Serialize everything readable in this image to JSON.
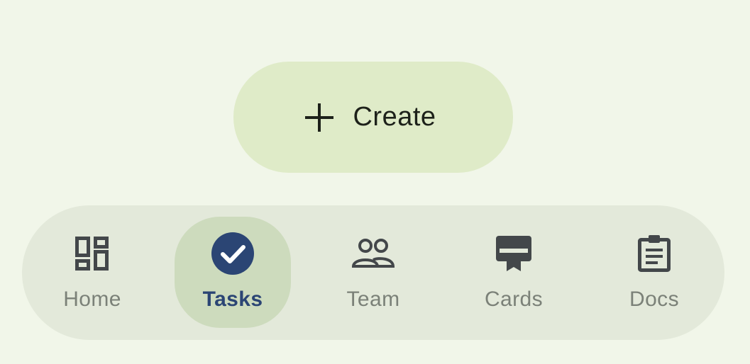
{
  "fab": {
    "label": "Create",
    "icon": "plus-icon"
  },
  "nav": {
    "items": [
      {
        "label": "Home",
        "icon": "dashboard-icon",
        "active": false
      },
      {
        "label": "Tasks",
        "icon": "check-circle-icon",
        "active": true
      },
      {
        "label": "Team",
        "icon": "people-icon",
        "active": false
      },
      {
        "label": "Cards",
        "icon": "card-membership-icon",
        "active": false
      },
      {
        "label": "Docs",
        "icon": "clipboard-icon",
        "active": false
      }
    ]
  },
  "colors": {
    "background": "#f1f6e9",
    "fab_background": "#dfebc8",
    "nav_background": "#e3e9da",
    "active_indicator": "#cddbbd",
    "active_accent": "#2b4574",
    "inactive_label": "#7b8178",
    "icon": "#43474a"
  }
}
